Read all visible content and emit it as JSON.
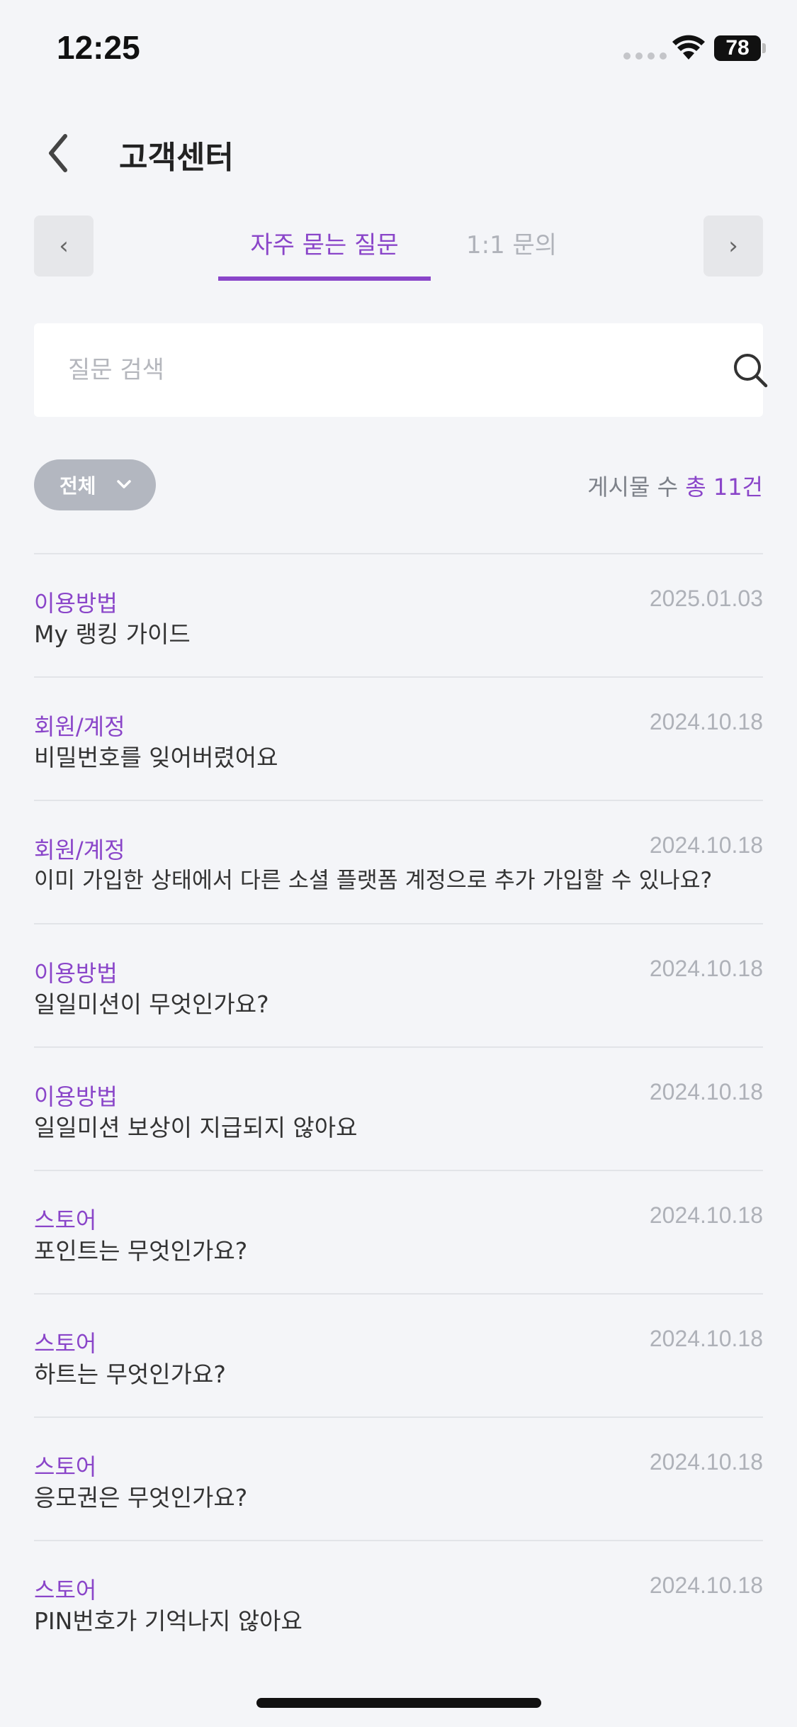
{
  "status_bar": {
    "time": "12:25",
    "battery": "78"
  },
  "header": {
    "title": "고객센터"
  },
  "tabs": {
    "prev_label": "‹",
    "next_label": "›",
    "items": [
      {
        "label": "자주 묻는 질문",
        "active": true
      },
      {
        "label": "1:1 문의",
        "active": false
      }
    ]
  },
  "search": {
    "placeholder": "질문 검색",
    "value": ""
  },
  "filter": {
    "selected": "전체",
    "count_prefix": "게시물 수 ",
    "count_value": "총 11건"
  },
  "faq_items": [
    {
      "category": "이용방법",
      "date": "2025.01.03",
      "question": "My 랭킹 가이드"
    },
    {
      "category": "회원/계정",
      "date": "2024.10.18",
      "question": "비밀번호를 잊어버렸어요"
    },
    {
      "category": "회원/계정",
      "date": "2024.10.18",
      "question": "이미 가입한 상태에서 다른 소셜 플랫폼 계정으로 추가 가입할 수 있나요?"
    },
    {
      "category": "이용방법",
      "date": "2024.10.18",
      "question": "일일미션이 무엇인가요?"
    },
    {
      "category": "이용방법",
      "date": "2024.10.18",
      "question": "일일미션 보상이 지급되지 않아요"
    },
    {
      "category": "스토어",
      "date": "2024.10.18",
      "question": "포인트는 무엇인가요?"
    },
    {
      "category": "스토어",
      "date": "2024.10.18",
      "question": "하트는 무엇인가요?"
    },
    {
      "category": "스토어",
      "date": "2024.10.18",
      "question": "응모권은 무엇인가요?"
    },
    {
      "category": "스토어",
      "date": "2024.10.18",
      "question": "PIN번호가 기억나지 않아요"
    }
  ],
  "colors": {
    "accent": "#8a45c9",
    "background": "#f4f5f8",
    "filter_pill": "#b3b7c0"
  }
}
